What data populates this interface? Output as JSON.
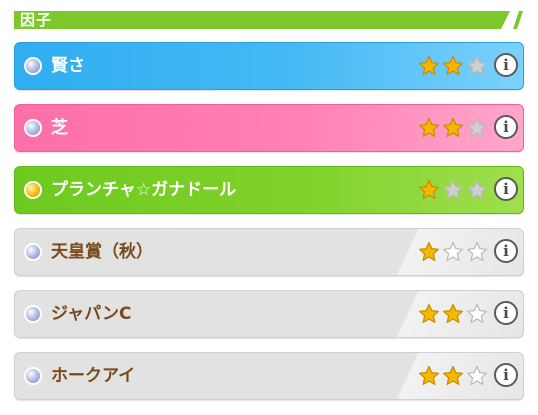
{
  "header": {
    "title": "因子"
  },
  "factors": [
    {
      "name": "賢さ",
      "theme": "blue",
      "dot": "silver",
      "rating": 2,
      "max_rating": 3,
      "info_label": "i"
    },
    {
      "name": "芝",
      "theme": "pink",
      "dot": "silver",
      "rating": 2,
      "max_rating": 3,
      "info_label": "i"
    },
    {
      "name": "プランチャ☆ガナドール",
      "theme": "green",
      "dot": "gold",
      "rating": 1,
      "max_rating": 3,
      "info_label": "i"
    },
    {
      "name": "天皇賞（秋）",
      "theme": "gray",
      "dot": "silver",
      "rating": 1,
      "max_rating": 3,
      "info_label": "i"
    },
    {
      "name": "ジャパンC",
      "theme": "gray",
      "dot": "silver",
      "rating": 2,
      "max_rating": 3,
      "info_label": "i"
    },
    {
      "name": "ホークアイ",
      "theme": "gray",
      "dot": "silver",
      "rating": 2,
      "max_rating": 3,
      "info_label": "i"
    }
  ],
  "colors": {
    "header_green": "#7cc82a",
    "blue": "#30aef0",
    "pink": "#fd6fa9",
    "green": "#6ec91f",
    "gray": "#e2e2e2",
    "star_filled": "#f5b800",
    "star_empty_on_color": "#cfcfcf",
    "star_empty_on_gray": "#ffffff"
  }
}
